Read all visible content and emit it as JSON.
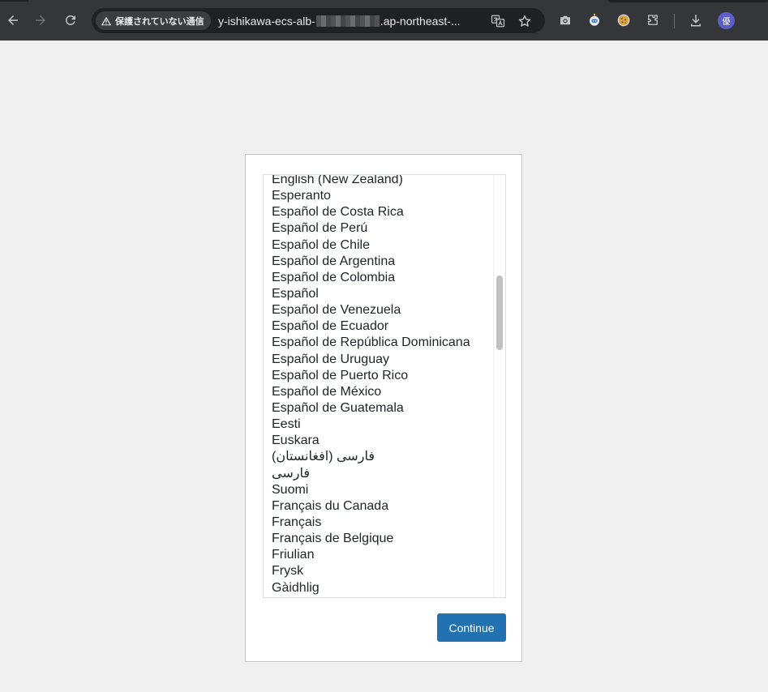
{
  "browser": {
    "security_label": "保護されていない通信",
    "url_start": "y-ishikawa-ecs-alb-",
    "url_end": ".ap-northeast-...",
    "profile_initial": "優",
    "toolbar_color": "#35363a"
  },
  "icons": {
    "back": "back-arrow-icon",
    "forward": "forward-arrow-icon",
    "reload": "reload-icon",
    "warning": "warning-triangle-icon",
    "translate": "translate-icon",
    "bookmark": "star-icon",
    "screenshot": "camera-icon",
    "extension_1": "robot-extension-icon",
    "extension_2": "cookie-extension-icon",
    "extensions": "puzzle-icon",
    "downloads": "download-icon"
  },
  "language_list": {
    "items": [
      "English (New Zealand)",
      "Esperanto",
      "Español de Costa Rica",
      "Español de Perú",
      "Español de Chile",
      "Español de Argentina",
      "Español de Colombia",
      "Español",
      "Español de Venezuela",
      "Español de Ecuador",
      "Español de República Dominicana",
      "Español de Uruguay",
      "Español de Puerto Rico",
      "Español de México",
      "Español de Guatemala",
      "Eesti",
      "Euskara",
      "فارسی (افغانستان)",
      "فارسی",
      "Suomi",
      "Français du Canada",
      "Français",
      "Français de Belgique",
      "Friulian",
      "Frysk",
      "Gàidhlig"
    ]
  },
  "continue_label": "Continue",
  "accent_color": "#2271b1"
}
